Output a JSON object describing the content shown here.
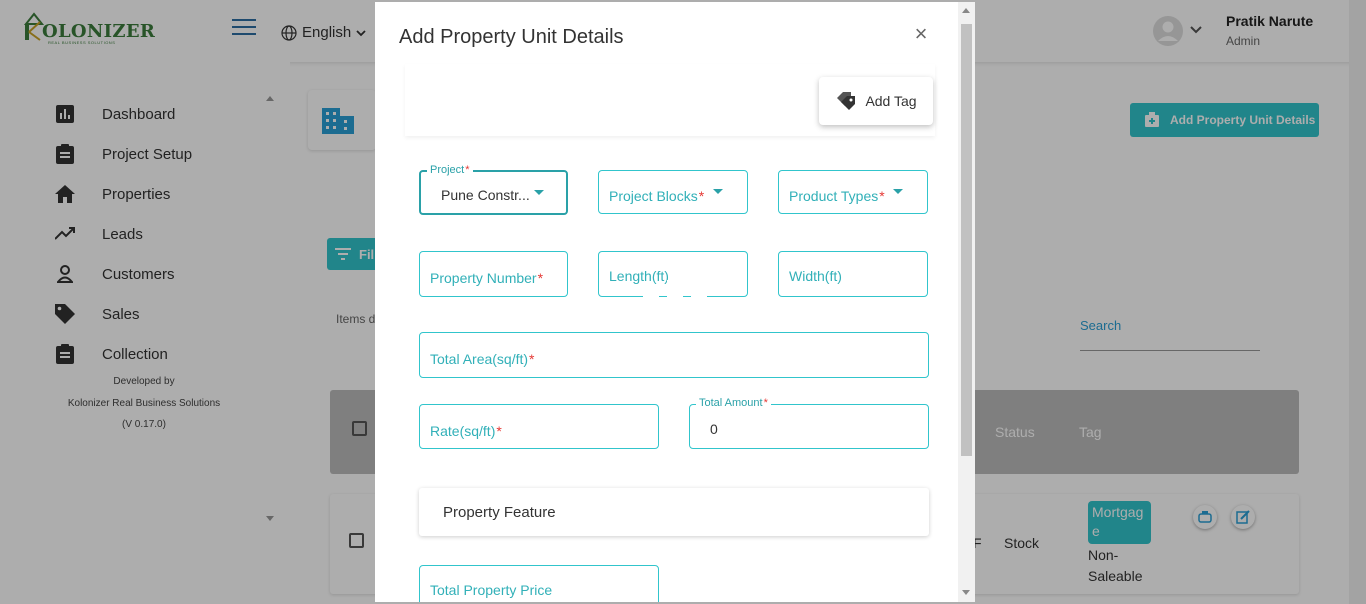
{
  "app": {
    "logo_text": "OLONIZER",
    "logo_sub": "REAL BUSINESS SOLUTIONS",
    "language": "English",
    "user": {
      "name": "Pratik Narute",
      "role": "Admin"
    }
  },
  "sidebar": {
    "items": [
      {
        "label": "Dashboard",
        "icon": "bar-chart-icon"
      },
      {
        "label": "Project Setup",
        "icon": "clipboard-icon"
      },
      {
        "label": "Properties",
        "icon": "home-icon"
      },
      {
        "label": "Leads",
        "icon": "trending-up-icon"
      },
      {
        "label": "Customers",
        "icon": "person-icon"
      },
      {
        "label": "Sales",
        "icon": "tag-icon"
      },
      {
        "label": "Collection",
        "icon": "clipboard-icon"
      }
    ],
    "footer": {
      "developed_by": "Developed by",
      "company": "Kolonizer Real Business Solutions",
      "version": "(V 0.17.0)"
    }
  },
  "page": {
    "add_button": "Add Property Unit Details",
    "filter_label": "Fil",
    "items_label": "Items d",
    "search_placeholder": "Search",
    "table": {
      "headers": {
        "status": "Status",
        "tag": "Tag"
      },
      "row": {
        "col_f": "F",
        "status": "Stock",
        "tag_badge": "Mortgage",
        "tag_extra": "Non-Saleable"
      }
    }
  },
  "modal": {
    "title": "Add Property Unit Details",
    "add_tag": "Add Tag",
    "fields": {
      "project": {
        "label": "Project",
        "value": "Pune Constr..."
      },
      "project_blocks": {
        "placeholder": "Project Blocks"
      },
      "product_types": {
        "placeholder": "Product Types"
      },
      "property_number": {
        "placeholder": "Property Number"
      },
      "length": {
        "placeholder": "Length(ft)"
      },
      "width": {
        "placeholder": "Width(ft)"
      },
      "total_area": {
        "placeholder": "Total Area(sq/ft)"
      },
      "rate": {
        "placeholder": "Rate(sq/ft)"
      },
      "total_amount": {
        "label": "Total Amount",
        "value": "0"
      },
      "total_property_price": {
        "placeholder": "Total Property Price"
      }
    },
    "property_feature": "Property Feature",
    "required_marker": "*"
  },
  "colors": {
    "accent": "#31c5cc",
    "accent_dark": "#2aa1a8",
    "required": "#e53935",
    "backdrop": "rgba(0,0,0,0.32)"
  }
}
